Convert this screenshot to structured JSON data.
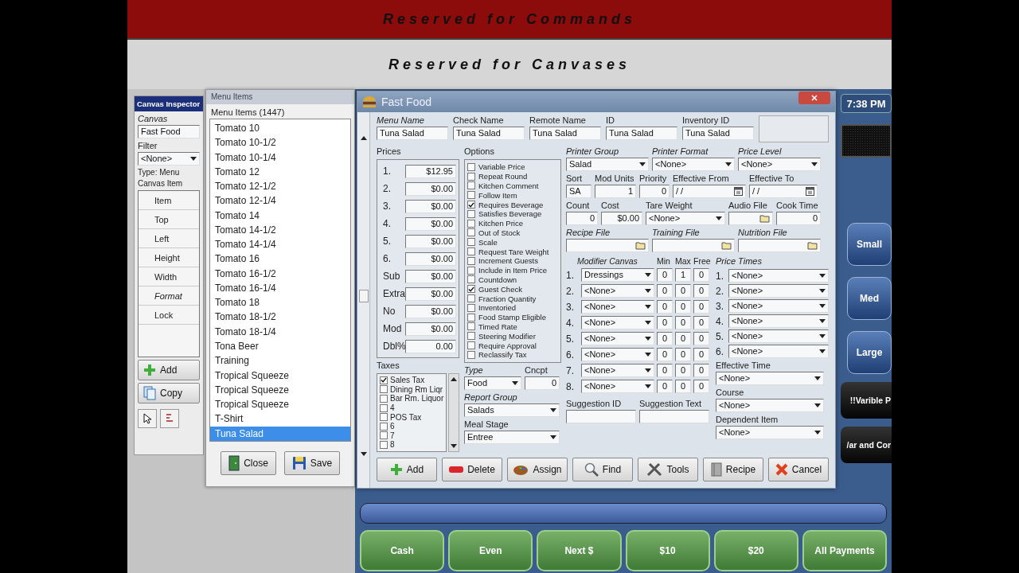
{
  "header": {
    "commands": "Reserved for Commands",
    "canvases": "Reserved for Canvases"
  },
  "canvas_inspector": {
    "title": "Canvas Inspector",
    "canvas_label": "Canvas",
    "canvas_value": "Fast Food",
    "filter_label": "Filter",
    "filter_value": "<None>",
    "type_text": "Type: Menu",
    "canvas_item_text": "Canvas Item",
    "properties": [
      {
        "label": "Item",
        "italic": false
      },
      {
        "label": "Top",
        "italic": false
      },
      {
        "label": "Left",
        "italic": false
      },
      {
        "label": "Height",
        "italic": false
      },
      {
        "label": "Width",
        "italic": false
      },
      {
        "label": "Format",
        "italic": true
      },
      {
        "label": "Lock",
        "italic": false
      }
    ],
    "buttons": [
      "Add",
      "Copy"
    ]
  },
  "menu_items": {
    "title": "Menu Items",
    "count_label": "Menu Items  (1447)",
    "items": [
      {
        "label": "Tomato 10",
        "selected": false
      },
      {
        "label": "Tomato 10-1/2",
        "selected": false
      },
      {
        "label": "Tomato 10-1/4",
        "selected": false
      },
      {
        "label": "Tomato 12",
        "selected": false
      },
      {
        "label": "Tomato 12-1/2",
        "selected": false
      },
      {
        "label": "Tomato 12-1/4",
        "selected": false
      },
      {
        "label": "Tomato 14",
        "selected": false
      },
      {
        "label": "Tomato 14-1/2",
        "selected": false
      },
      {
        "label": "Tomato 14-1/4",
        "selected": false
      },
      {
        "label": "Tomato 16",
        "selected": false
      },
      {
        "label": "Tomato 16-1/2",
        "selected": false
      },
      {
        "label": "Tomato 16-1/4",
        "selected": false
      },
      {
        "label": "Tomato 18",
        "selected": false
      },
      {
        "label": "Tomato 18-1/2",
        "selected": false
      },
      {
        "label": "Tomato 18-1/4",
        "selected": false
      },
      {
        "label": "Tona Beer",
        "selected": false
      },
      {
        "label": "Training",
        "selected": false
      },
      {
        "label": "Tropical Squeeze",
        "selected": false
      },
      {
        "label": "Tropical Squeeze",
        "selected": false
      },
      {
        "label": "Tropical Squeeze",
        "selected": false
      },
      {
        "label": "T-Shirt",
        "selected": false
      },
      {
        "label": "Tuna Salad",
        "selected": true
      }
    ],
    "buttons": [
      "Close",
      "Save"
    ]
  },
  "editor": {
    "title": "Fast Food",
    "header_fields": [
      {
        "label": "Menu Name",
        "value": "Tuna Salad",
        "italic": true
      },
      {
        "label": "Check Name",
        "value": "Tuna Salad",
        "italic": false
      },
      {
        "label": "Remote Name",
        "value": "Tuna Salad",
        "italic": false
      },
      {
        "label": "ID",
        "value": "Tuna Salad",
        "italic": false
      },
      {
        "label": "Inventory ID",
        "value": "Tuna Salad",
        "italic": false
      }
    ],
    "prices": {
      "label": "Prices",
      "rows": [
        {
          "label": "1.",
          "value": "$12.95"
        },
        {
          "label": "2.",
          "value": "$0.00"
        },
        {
          "label": "3.",
          "value": "$0.00"
        },
        {
          "label": "4.",
          "value": "$0.00"
        },
        {
          "label": "5.",
          "value": "$0.00"
        },
        {
          "label": "6.",
          "value": "$0.00"
        },
        {
          "label": "Sub",
          "value": "$0.00"
        },
        {
          "label": "Extra",
          "value": "$0.00"
        },
        {
          "label": "No",
          "value": "$0.00"
        },
        {
          "label": "Mod",
          "value": "$0.00"
        },
        {
          "label": "Dbl%",
          "value": "0.00"
        }
      ]
    },
    "options": {
      "label": "Options",
      "items": [
        {
          "label": "Variable Price",
          "checked": false
        },
        {
          "label": "Repeat Round",
          "checked": false
        },
        {
          "label": "Kitchen Comment",
          "checked": false
        },
        {
          "label": "Follow Item",
          "checked": false
        },
        {
          "label": "Requires Beverage",
          "checked": true
        },
        {
          "label": "Satisfies Beverage",
          "checked": false
        },
        {
          "label": "Kitchen Price",
          "checked": false
        },
        {
          "label": "Out of Stock",
          "checked": false
        },
        {
          "label": "Scale",
          "checked": false
        },
        {
          "label": "Request Tare Weight",
          "checked": false
        },
        {
          "label": "Increment Guests",
          "checked": false
        },
        {
          "label": "Include in Item Price",
          "checked": false
        },
        {
          "label": "Countdown",
          "checked": false
        },
        {
          "label": "Guest  Check",
          "checked": true
        },
        {
          "label": "Fraction Quantity",
          "checked": false
        },
        {
          "label": "Inventoried",
          "checked": false
        },
        {
          "label": "Food Stamp Eligible",
          "checked": false
        },
        {
          "label": "Timed Rate",
          "checked": false
        },
        {
          "label": "Steering Modifier",
          "checked": false
        },
        {
          "label": "Require Approval",
          "checked": false
        },
        {
          "label": "Reclassify Tax",
          "checked": false
        }
      ]
    },
    "taxes": {
      "label": "Taxes",
      "items": [
        {
          "label": "Sales Tax",
          "checked": true
        },
        {
          "label": "Dining Rm Liqr",
          "checked": false
        },
        {
          "label": "Bar Rm. Liquor",
          "checked": false
        },
        {
          "label": "4",
          "checked": false
        },
        {
          "label": "POS Tax",
          "checked": false
        },
        {
          "label": "6",
          "checked": false
        },
        {
          "label": "7",
          "checked": false
        },
        {
          "label": "8",
          "checked": false
        }
      ]
    },
    "classification": [
      {
        "label": "Type",
        "value": "Food",
        "kind": "select",
        "italic": true
      },
      {
        "label": "Cncpt",
        "value": "0",
        "kind": "number",
        "italic": false
      },
      {
        "label": "Report Group",
        "value": "Salads",
        "kind": "select",
        "italic": true
      },
      {
        "label": "Meal Stage",
        "value": "Entree",
        "kind": "select",
        "italic": false
      }
    ],
    "detail_rows": [
      [
        {
          "label": "Printer Group",
          "value": "Salad",
          "kind": "select",
          "italic": true
        },
        {
          "label": "Printer Format",
          "value": "<None>",
          "kind": "select",
          "italic": true
        },
        {
          "label": "Price Level",
          "value": "<None>",
          "kind": "select",
          "italic": true
        }
      ],
      [
        {
          "label": "Sort",
          "value": "SA",
          "italic": false
        },
        {
          "label": "Mod Units",
          "value": "1",
          "kind": "number",
          "italic": false
        },
        {
          "label": "Priority",
          "value": "0",
          "kind": "number",
          "italic": false
        },
        {
          "label": "Effective From",
          "value": "/ /",
          "kind": "date",
          "italic": false
        },
        {
          "label": "Effective To",
          "value": "/ /",
          "kind": "date",
          "italic": false
        }
      ],
      [
        {
          "label": "Count",
          "value": "0",
          "kind": "number",
          "italic": false
        },
        {
          "label": "Cost",
          "value": "$0.00",
          "kind": "number",
          "italic": false
        },
        {
          "label": "Tare Weight",
          "value": "<None>",
          "kind": "select",
          "italic": false
        },
        {
          "label": "Audio File",
          "kind": "file",
          "italic": false
        },
        {
          "label": "Cook Time",
          "value": "0",
          "kind": "number",
          "italic": false
        }
      ],
      [
        {
          "label": "Recipe File",
          "kind": "file",
          "italic": true
        },
        {
          "label": "Training File",
          "kind": "file",
          "italic": true
        },
        {
          "label": "Nutrition File",
          "kind": "file",
          "italic": true
        }
      ]
    ],
    "modifiers": {
      "canvas_label": "Modifier Canvas",
      "min_label": "Min",
      "max_label": "Max",
      "free_label": "Free",
      "rows": [
        {
          "index": "1.",
          "canvas": "Dressings",
          "min": "0",
          "max": "1",
          "free": "0"
        },
        {
          "index": "2.",
          "canvas": "<None>",
          "min": "0",
          "max": "0",
          "free": "0"
        },
        {
          "index": "3.",
          "canvas": "<None>",
          "min": "0",
          "max": "0",
          "free": "0"
        },
        {
          "index": "4.",
          "canvas": "<None>",
          "min": "0",
          "max": "0",
          "free": "0"
        },
        {
          "index": "5.",
          "canvas": "<None>",
          "min": "0",
          "max": "0",
          "free": "0"
        },
        {
          "index": "6.",
          "canvas": "<None>",
          "min": "0",
          "max": "0",
          "free": "0"
        },
        {
          "index": "7.",
          "canvas": "<None>",
          "min": "0",
          "max": "0",
          "free": "0"
        },
        {
          "index": "8.",
          "canvas": "<None>",
          "min": "0",
          "max": "0",
          "free": "0"
        }
      ]
    },
    "price_times": {
      "label": "Price Times",
      "rows": [
        {
          "index": "1.",
          "value": "<None>"
        },
        {
          "index": "2.",
          "value": "<None>"
        },
        {
          "index": "3.",
          "value": "<None>"
        },
        {
          "index": "4.",
          "value": "<None>"
        },
        {
          "index": "5.",
          "value": "<None>"
        },
        {
          "index": "6.",
          "value": "<None>"
        }
      ]
    },
    "timing_fields": [
      {
        "label": "Effective Time",
        "value": "<None>",
        "kind": "select",
        "italic": false
      },
      {
        "label": "Course",
        "value": "<None>",
        "kind": "select",
        "italic": false
      },
      {
        "label": "Dependent Item",
        "value": "<None>",
        "kind": "select",
        "italic": false
      }
    ],
    "suggestion_fields": [
      {
        "label": "Suggestion ID",
        "italic": false
      },
      {
        "label": "Suggestion Text",
        "italic": false
      }
    ],
    "buttons": [
      "Add",
      "Delete",
      "Assign",
      "Find",
      "Tools",
      "Recipe",
      "Cancel"
    ]
  },
  "side_panel": {
    "time": "7:38 PM",
    "size_buttons": [
      "Small",
      "Med",
      "Large"
    ],
    "dark_buttons": [
      "!!Varible P",
      "/ar and Cor"
    ]
  },
  "payment_buttons": [
    "Cash",
    "Even",
    "Next $",
    "$10",
    "$20",
    "All Payments"
  ]
}
